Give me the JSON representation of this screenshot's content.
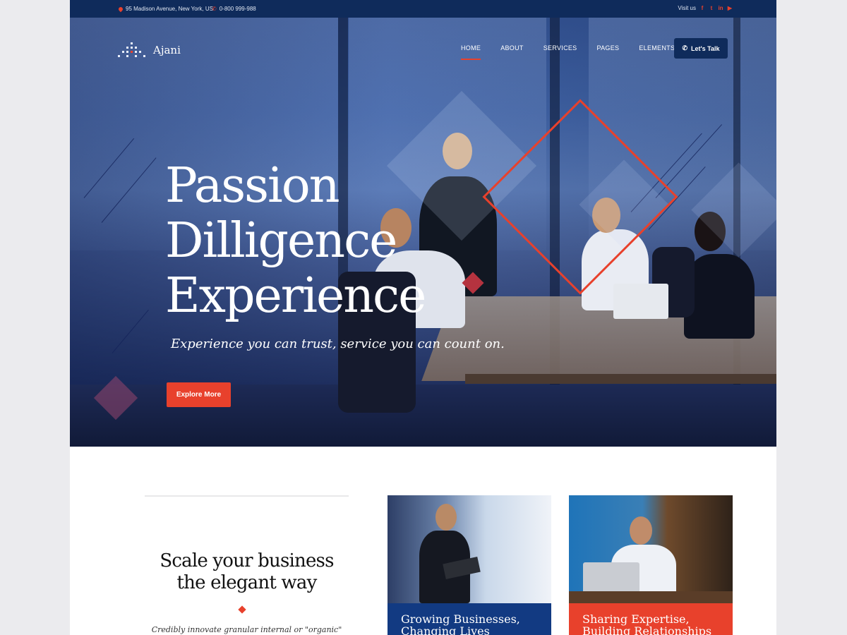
{
  "topbar": {
    "address": "95 Madison  Avenue, New York, US",
    "phone": "0-800 999-988",
    "visit_label": "Visit us",
    "social": [
      {
        "icon": "facebook-icon",
        "glyph": "f"
      },
      {
        "icon": "twitter-icon",
        "glyph": "t"
      },
      {
        "icon": "linkedin-icon",
        "glyph": "in"
      },
      {
        "icon": "youtube-icon",
        "glyph": "▶"
      }
    ]
  },
  "brand": {
    "name": "Ajani"
  },
  "nav": {
    "items": [
      {
        "label": "HOME",
        "active": true
      },
      {
        "label": "ABOUT",
        "active": false
      },
      {
        "label": "SERVICES",
        "active": false
      },
      {
        "label": "PAGES",
        "active": false
      },
      {
        "label": "ELEMENTS",
        "active": false
      }
    ],
    "cta_label": "Let's Talk"
  },
  "hero": {
    "headline_lines": [
      "Passion",
      "Dilligence",
      "Experience"
    ],
    "tagline": "Experience you can trust, service you can count on.",
    "button_label": "Explore More"
  },
  "intro": {
    "title_lines": [
      "Scale your business",
      "the elegant way"
    ],
    "text": "Credibly innovate granular internal or \"organic\" sources"
  },
  "cards": [
    {
      "title_lines": [
        "Growing Businesses,",
        "Changing Lives"
      ],
      "color": "#123a82"
    },
    {
      "title_lines": [
        "Sharing Expertise,",
        "Building Relationships"
      ],
      "color": "#e8412c"
    }
  ],
  "colors": {
    "accent": "#e8412c",
    "navy": "#0f2b5b"
  }
}
